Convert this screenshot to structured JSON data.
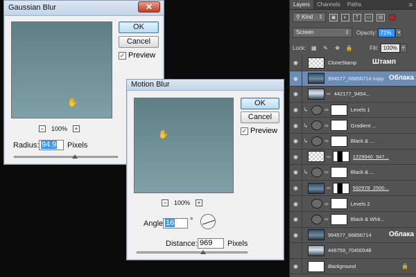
{
  "gaussian_blur": {
    "title": "Gaussian Blur",
    "close_glyph": "✕",
    "ok_label": "OK",
    "cancel_label": "Cancel",
    "preview_label": "Preview",
    "preview_checked": "✓",
    "zoom_minus": "−",
    "zoom_plus": "+",
    "zoom_value": "100%",
    "radius_label": "Radius:",
    "radius_value": "94.9",
    "radius_unit": "Pixels"
  },
  "motion_blur": {
    "title": "Motion Blur",
    "ok_label": "OK",
    "cancel_label": "Cancel",
    "preview_label": "Preview",
    "preview_checked": "✓",
    "zoom_minus": "−",
    "zoom_plus": "+",
    "zoom_value": "100%",
    "angle_label": "Angle:",
    "angle_value": "16",
    "angle_unit": "°",
    "distance_label": "Distance:",
    "distance_value": "969",
    "distance_unit": "Pixels"
  },
  "layers_panel": {
    "tabs": [
      "Layers",
      "Channels",
      "Paths"
    ],
    "menu_glyph": "≡",
    "kind_label": "Kind",
    "kind_icon": "search-icon",
    "blend_mode": "Screen",
    "opacity_label": "Opacity:",
    "opacity_value": "71%",
    "lock_label": "Lock:",
    "fill_label": "Fill:",
    "fill_value": "100%",
    "eye_glyph": "👁",
    "link_glyph": "∞",
    "layers": [
      {
        "name": "CloneStamp",
        "annotation": "Штамп"
      },
      {
        "name": "994577_66856714 copy",
        "annotation": "Облака"
      },
      {
        "name": "442177_9454..."
      },
      {
        "name": "Levels 1"
      },
      {
        "name": "Gradient ..."
      },
      {
        "name": "Black & ..."
      },
      {
        "name": "1229940_947..."
      },
      {
        "name": "Black & ..."
      },
      {
        "name": "592978_2500..."
      },
      {
        "name": "Levels 2"
      },
      {
        "name": "Black & Whit..."
      },
      {
        "name": "994577_66856714",
        "annotation": "Облака"
      },
      {
        "name": "446759_70400548"
      },
      {
        "name": "Background"
      }
    ]
  }
}
